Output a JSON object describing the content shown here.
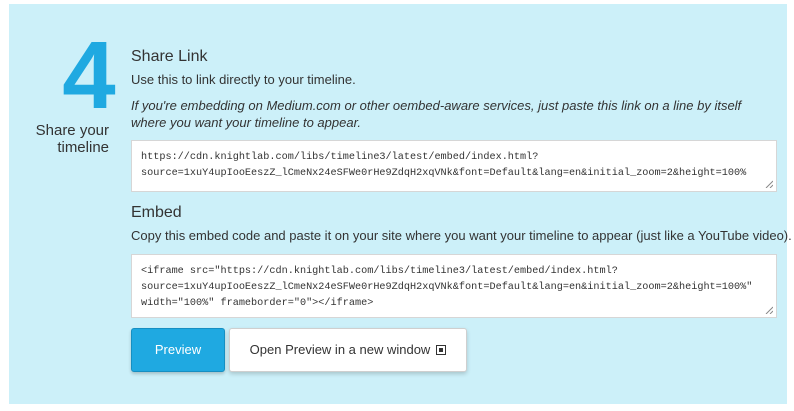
{
  "step": {
    "number": "4",
    "label": "Share your timeline"
  },
  "share_link": {
    "heading": "Share Link",
    "description": "Use this to link directly to your timeline.",
    "note": "If you're embedding on Medium.com or other oembed-aware services, just paste this link on a line by itself where you want your timeline to appear.",
    "url_lines": [
      "https://cdn.knightlab.com/libs/timeline3/latest/embed/index.html?",
      "source=1xuY4upIooEeszZ_lCmeNx24eSFWe0rHe9ZdqH2xqVNk&font=Default&lang=en&initial_zoom=2&height=100%"
    ]
  },
  "embed": {
    "heading": "Embed",
    "description": "Copy this embed code and paste it on your site where you want your timeline to appear (just like a YouTube video).",
    "code_lines": [
      "<iframe src=\"https://cdn.knightlab.com/libs/timeline3/latest/embed/index.html?",
      "source=1xuY4upIooEeszZ_lCmeNx24eSFWe0rHe9ZdqH2xqVNk&font=Default&lang=en&initial_zoom=2&height=100%\"",
      "width=\"100%\" frameborder=\"0\"></iframe>"
    ]
  },
  "buttons": {
    "preview": "Preview",
    "open_new_window": "Open Preview in a new window"
  },
  "colors": {
    "panel_bg": "#ccf0f9",
    "accent": "#1fa9e1"
  }
}
